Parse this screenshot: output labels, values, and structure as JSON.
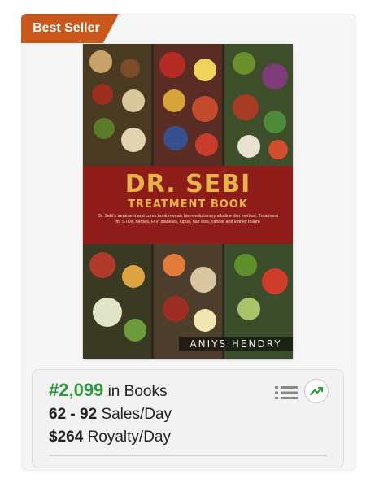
{
  "badge": {
    "label": "Best Seller"
  },
  "book": {
    "title_line1": "DR. SEBI",
    "title_line2": "TREATMENT BOOK",
    "subtitle": "Dr. Sebi's treatment and cures book reveals his revolutionary alkaline diet method. Treatment for STDs, herpes, HIV, diabetes, lupus, hair loss, cancer and kidney failure",
    "author": "ANIYS HENDRY"
  },
  "stats": {
    "rank": "#2,099",
    "rank_category": "in Books",
    "sales_range": "62 - 92",
    "sales_unit": "Sales/Day",
    "royalty": "$264",
    "royalty_unit": "Royalty/Day"
  },
  "icons": {
    "list": "list-icon",
    "trend": "trend-chart-icon"
  },
  "colors": {
    "badge": "#c8581b",
    "rank": "#2e9a3a",
    "title_band": "#8e1d1a",
    "title_text": "#e8b24a"
  }
}
